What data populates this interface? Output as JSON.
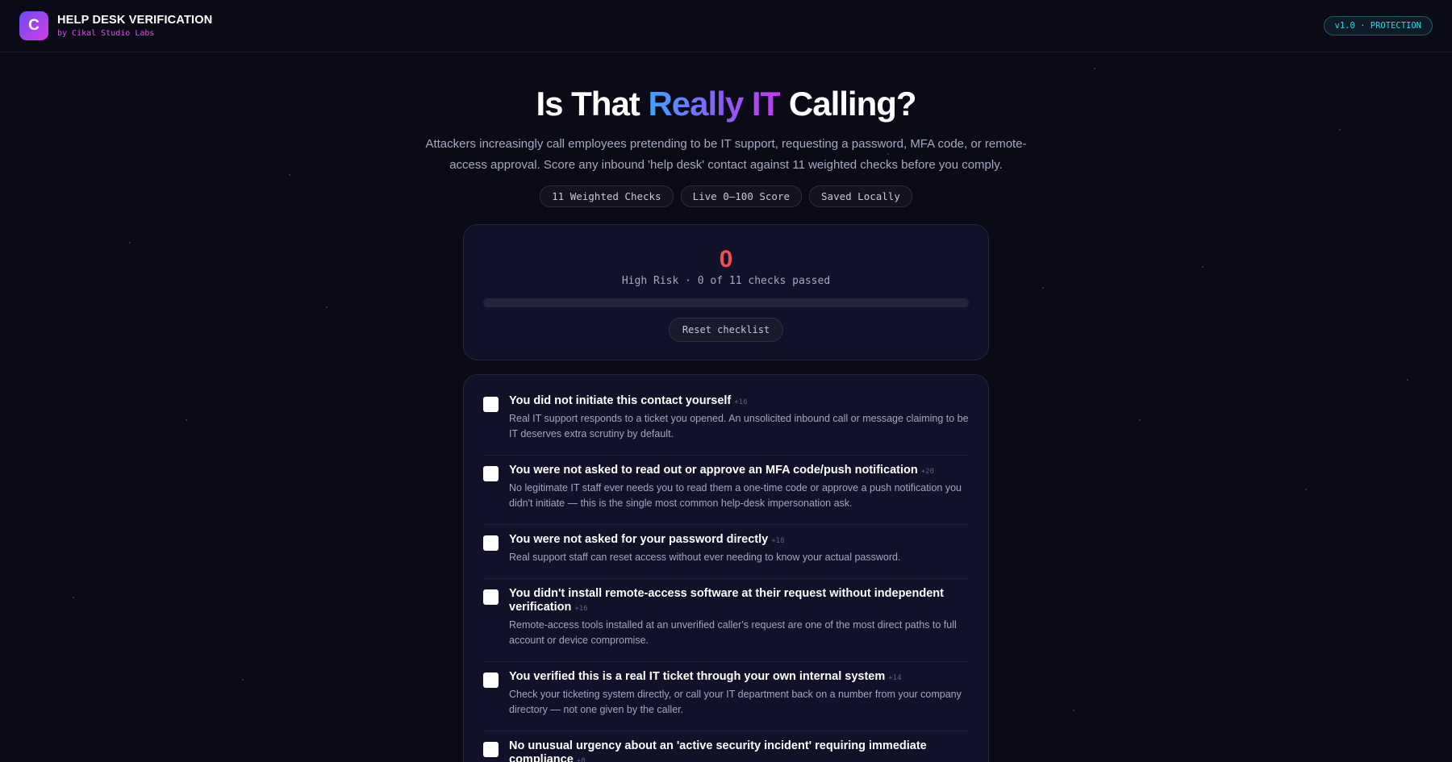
{
  "header": {
    "logo_letter": "C",
    "title": "HELP DESK VERIFICATION",
    "subtitle": "by Cikal Studio Labs",
    "version_badge": "v1.0 · PROTECTION"
  },
  "hero": {
    "title_before": "Is That",
    "title_highlight": "Really IT",
    "title_after": "Calling?",
    "subtitle": "Attackers increasingly call employees pretending to be IT support, requesting a password, MFA code, or remote-access approval. Score any inbound 'help desk' contact against 11 weighted checks before you comply.",
    "chips": [
      "11 Weighted Checks",
      "Live 0–100 Score",
      "Saved Locally"
    ]
  },
  "score": {
    "value": "0",
    "status": "High Risk · 0 of 11 checks passed",
    "progress_fraction": 0,
    "reset_label": "Reset checklist",
    "color": "#f0504f"
  },
  "checklist": [
    {
      "title": "You did not initiate this contact yourself",
      "weight": "+16",
      "description": "Real IT support responds to a ticket you opened. An unsolicited inbound call or message claiming to be IT deserves extra scrutiny by default.",
      "checked": false
    },
    {
      "title": "You were not asked to read out or approve an MFA code/push notification",
      "weight": "+20",
      "description": "No legitimate IT staff ever needs you to read them a one-time code or approve a push notification you didn't initiate — this is the single most common help-desk impersonation ask.",
      "checked": false
    },
    {
      "title": "You were not asked for your password directly",
      "weight": "+18",
      "description": "Real support staff can reset access without ever needing to know your actual password.",
      "checked": false
    },
    {
      "title": "You didn't install remote-access software at their request without independent verification",
      "weight": "+16",
      "description": "Remote-access tools installed at an unverified caller's request are one of the most direct paths to full account or device compromise.",
      "checked": false
    },
    {
      "title": "You verified this is a real IT ticket through your own internal system",
      "weight": "+14",
      "description": "Check your ticketing system directly, or call your IT department back on a number from your company directory — not one given by the caller.",
      "checked": false
    },
    {
      "title": "No unusual urgency about an 'active security incident' requiring immediate compliance",
      "weight": "+8",
      "description": "",
      "checked": false
    }
  ]
}
